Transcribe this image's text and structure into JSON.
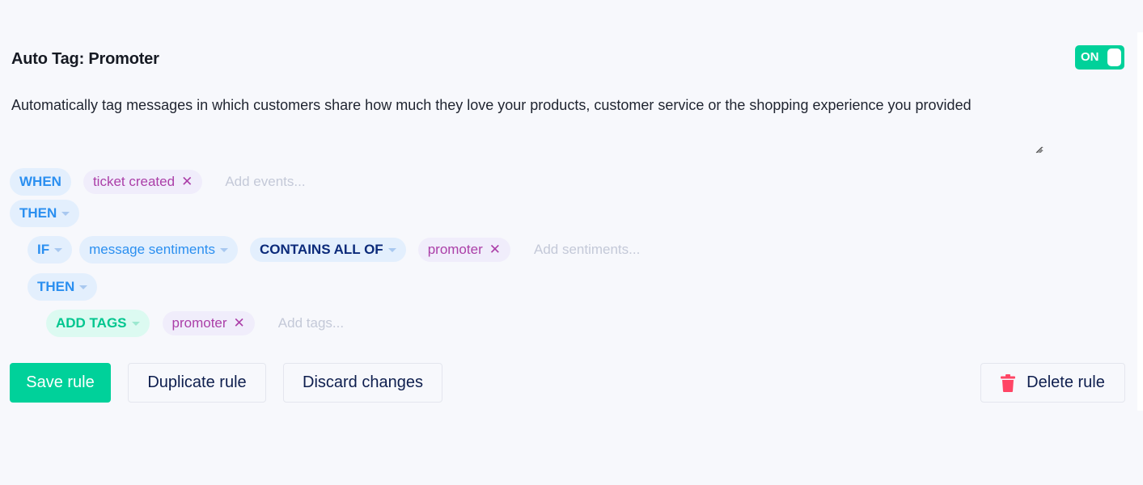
{
  "rule": {
    "title": "Auto Tag: Promoter",
    "toggle": {
      "label": "ON",
      "state": "on"
    },
    "description": "Automatically tag messages in which customers share how much they love your products, customer service or the shopping experience you provided"
  },
  "when": {
    "keyword": "WHEN",
    "events": [
      {
        "label": "ticket created",
        "remove_icon": "close-icon"
      }
    ],
    "placeholder": "Add events..."
  },
  "then": {
    "keyword": "THEN"
  },
  "condition": {
    "if_keyword": "IF",
    "field": "message sentiments",
    "operator": "CONTAINS ALL OF",
    "values": [
      {
        "label": "promoter",
        "remove_icon": "close-icon"
      }
    ],
    "placeholder": "Add sentiments..."
  },
  "inner_then": {
    "keyword": "THEN"
  },
  "action": {
    "type": "ADD TAGS",
    "tags": [
      {
        "label": "promoter",
        "remove_icon": "close-icon"
      }
    ],
    "placeholder": "Add tags..."
  },
  "buttons": {
    "save": "Save rule",
    "duplicate": "Duplicate rule",
    "discard": "Discard changes",
    "delete": "Delete rule",
    "delete_icon": "trash-icon"
  },
  "colors": {
    "accent_green": "#00d19a",
    "keyword_blue": "#2b8ff0",
    "operator_navy": "#0b2a7a",
    "tag_purple": "#ab3fa8",
    "delete_red": "#ff4565"
  }
}
